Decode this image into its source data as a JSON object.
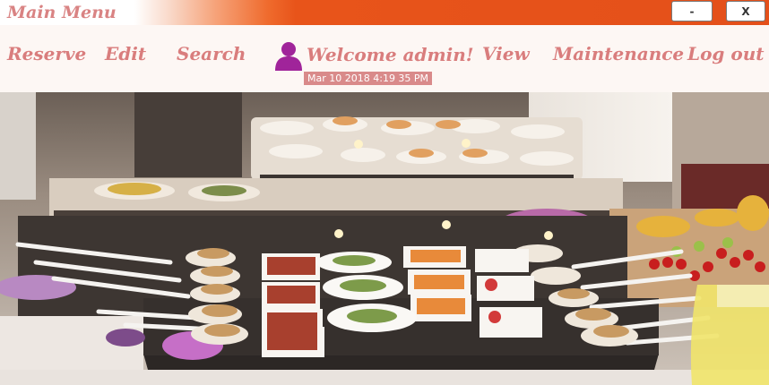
{
  "window": {
    "title": "Main Menu",
    "minimize_label": "-",
    "close_label": "X"
  },
  "menu": {
    "reserve": "Reserve",
    "edit": "Edit",
    "search": "Search",
    "welcome": "Welcome admin!",
    "view": "View",
    "maintenance": "Maintenance",
    "logout": "Log out"
  },
  "status": {
    "datetime": "Mar 10 2018  4:19 35 PM"
  },
  "colors": {
    "titlebar_accent": "#e4501a",
    "menu_text": "#d97d7d",
    "user_icon": "#a0249a",
    "datetime_bg": "#d98a8a"
  },
  "icons": {
    "user": "user-icon"
  }
}
